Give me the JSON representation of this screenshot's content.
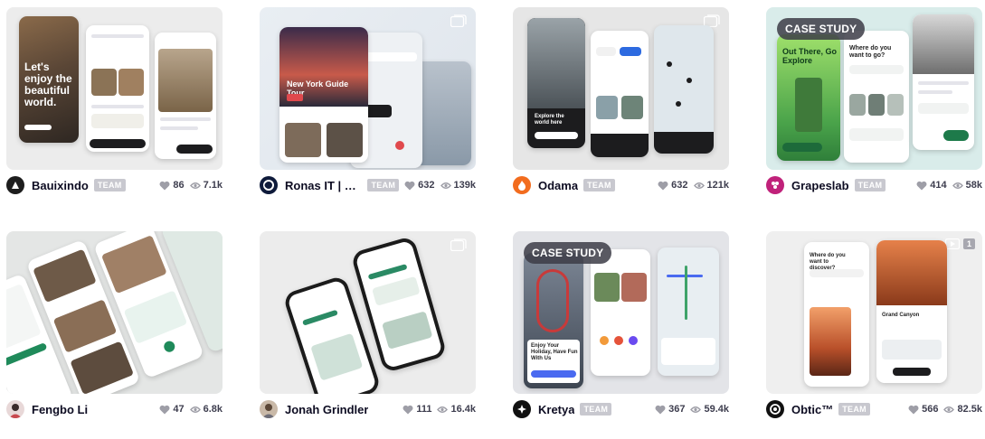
{
  "shots": [
    {
      "author": "Bauixindo",
      "team": "TEAM",
      "likes": "86",
      "views": "7.1k",
      "hero": "Let's enjoy the beautiful world."
    },
    {
      "author": "Ronas IT | UI...",
      "team": "TEAM",
      "likes": "632",
      "views": "139k",
      "hero": "New York Guide Tour"
    },
    {
      "author": "Odama",
      "team": "TEAM",
      "likes": "632",
      "views": "121k",
      "hero": "Explore the world here"
    },
    {
      "author": "Grapeslab",
      "team": "TEAM",
      "likes": "414",
      "views": "58k",
      "badge": "CASE STUDY",
      "hero": "Out There, Go Explore",
      "question": "Where do you want to go?"
    },
    {
      "author": "Fengbo Li",
      "likes": "47",
      "views": "6.8k"
    },
    {
      "author": "Jonah Grindler",
      "likes": "111",
      "views": "16.4k"
    },
    {
      "author": "Kretya",
      "team": "TEAM",
      "likes": "367",
      "views": "59.4k",
      "badge": "CASE STUDY",
      "hero": "Enjoy Your Holiday, Have Fun With Us"
    },
    {
      "author": "Obtic™",
      "team": "TEAM",
      "likes": "566",
      "views": "82.5k",
      "question": "Where do you want to discover?",
      "place": "Grand Canyon",
      "count": "1"
    }
  ],
  "colors": {
    "team_badge": "#c8c8cf",
    "heart": "#9e9ea7",
    "text": "#0d0c22"
  }
}
